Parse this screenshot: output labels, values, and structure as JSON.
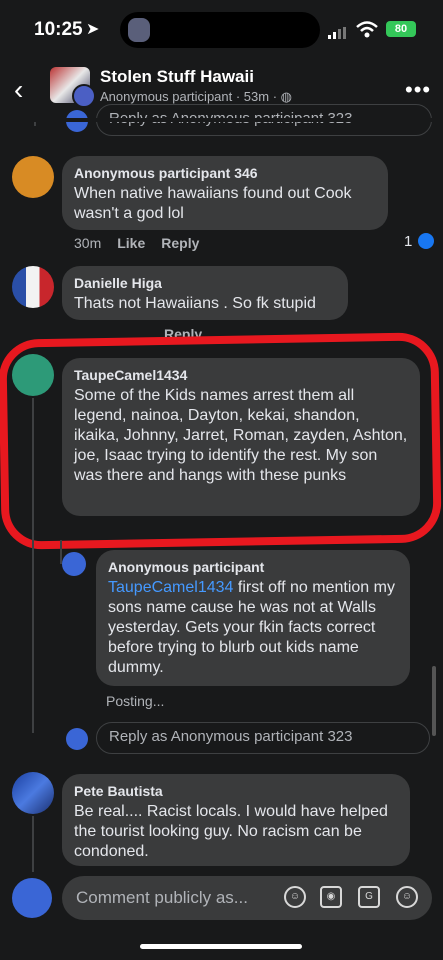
{
  "status": {
    "time": "10:25",
    "battery": "80"
  },
  "header": {
    "group_name": "Stolen Stuff Hawaii",
    "sub": "Anonymous participant · 53m · "
  },
  "reply_top": "Reply as Anonymous participant 323",
  "comments": [
    {
      "name": "Anonymous participant 346",
      "text": "When native hawaiians found out Cook wasn't a god lol",
      "time": "30m",
      "like": "Like",
      "reply": "Reply",
      "reactions": "1"
    },
    {
      "name": "Danielle Higa",
      "text": "Thats not Hawaiians . So fk stupid",
      "reply": "Reply"
    },
    {
      "name": "TaupeCamel1434",
      "text": "Some of the Kids names arrest them all legend, nainoa, Dayton, kekai, shandon, ikaika, Johnny, Jarret, Roman, zayden, Ashton, joe, Isaac trying to identify the rest. My son was there and hangs with these punks"
    },
    {
      "name": "Anonymous participant",
      "mention": "TaupeCamel1434",
      "text": " first off no mention my sons name cause he was not at Walls yesterday. Gets your fkin facts correct before trying to blurb out kids name dummy.",
      "status": "Posting..."
    },
    {
      "name": "Pete Bautista",
      "text": "Be real.... Racist locals.  I would have helped the tourist looking guy.  No racism can be condoned."
    }
  ],
  "reply_bottom": "Reply as Anonymous participant 323",
  "composer": {
    "placeholder": "Comment publicly as..."
  },
  "icons": [
    "back-icon",
    "more-icon",
    "like-reaction-icon",
    "avatar-sticker-icon",
    "camera-icon",
    "gif-icon",
    "emoji-icon"
  ],
  "colors": {
    "background": "#18191a",
    "bubble": "#3a3b3c",
    "link": "#4599ff",
    "highlight": "#e8181f"
  }
}
